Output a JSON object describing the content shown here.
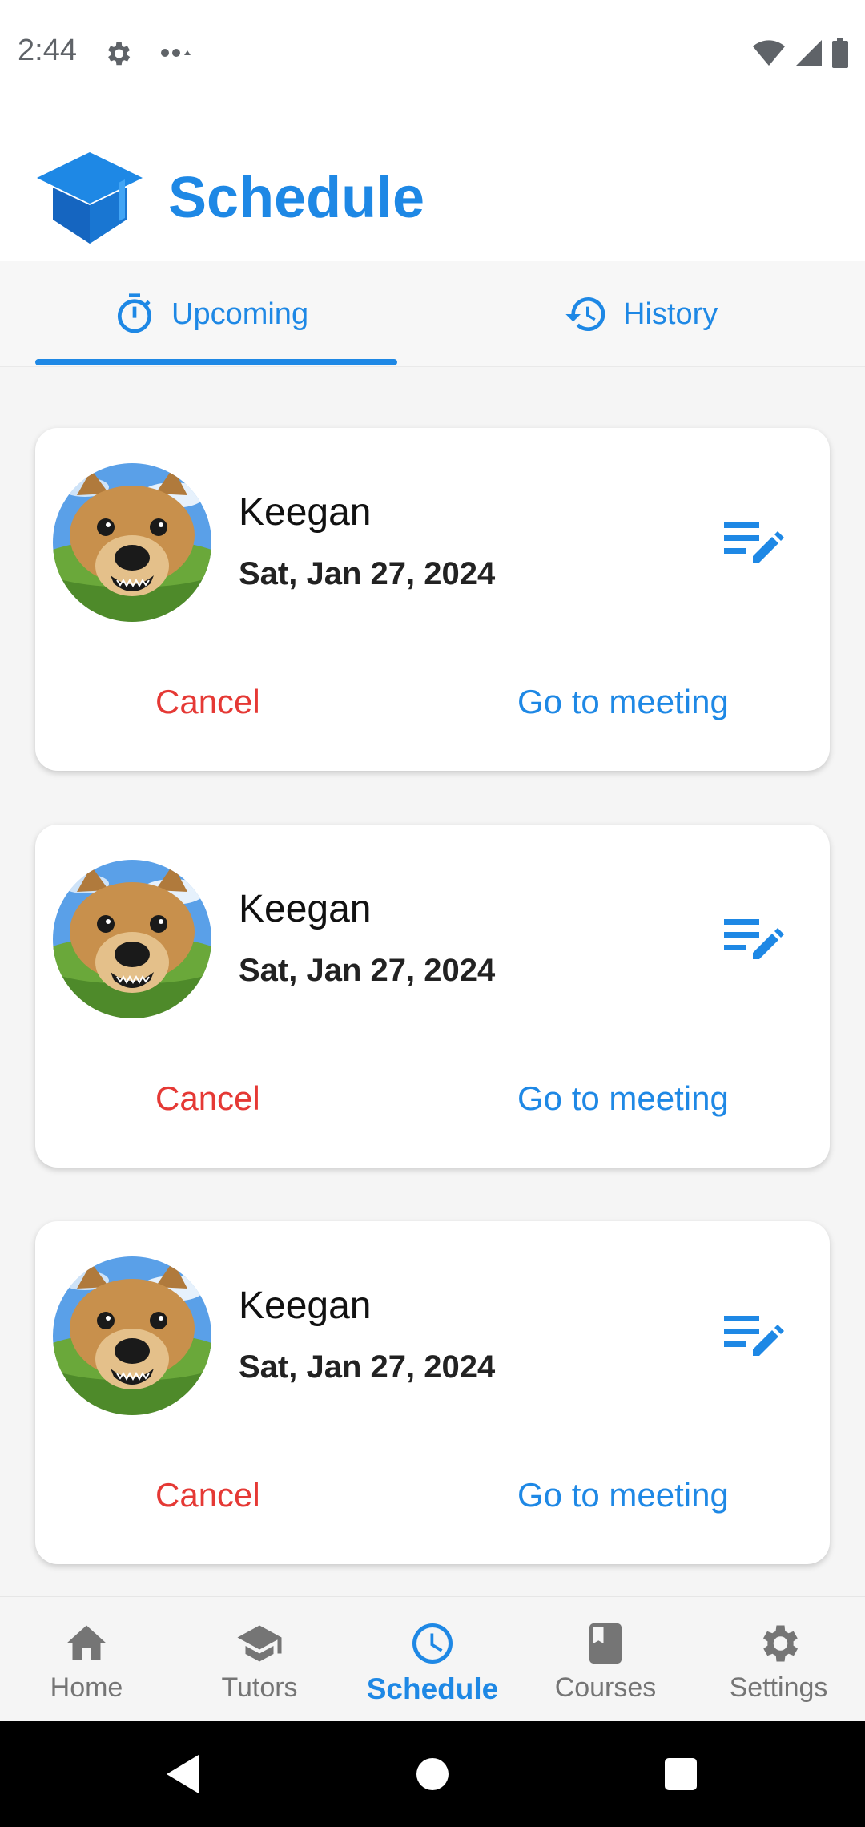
{
  "status_bar": {
    "time": "2:44"
  },
  "header": {
    "title": "Schedule"
  },
  "tabs": [
    {
      "label": "Upcoming",
      "icon": "timer-icon",
      "selected": true
    },
    {
      "label": "History",
      "icon": "history-icon",
      "selected": false
    }
  ],
  "cards": [
    {
      "name": "Keegan",
      "date": "Sat, Jan 27, 2024",
      "cancel_label": "Cancel",
      "meeting_label": "Go to meeting"
    },
    {
      "name": "Keegan",
      "date": "Sat, Jan 27, 2024",
      "cancel_label": "Cancel",
      "meeting_label": "Go to meeting"
    },
    {
      "name": "Keegan",
      "date": "Sat, Jan 27, 2024",
      "cancel_label": "Cancel",
      "meeting_label": "Go to meeting"
    }
  ],
  "bottom_nav": {
    "items": [
      {
        "label": "Home",
        "icon": "home-icon"
      },
      {
        "label": "Tutors",
        "icon": "school-icon"
      },
      {
        "label": "Schedule",
        "icon": "clock-icon",
        "active": true
      },
      {
        "label": "Courses",
        "icon": "book-icon"
      },
      {
        "label": "Settings",
        "icon": "gear-icon"
      }
    ]
  },
  "colors": {
    "primary": "#1e88e5",
    "danger": "#e53935"
  }
}
